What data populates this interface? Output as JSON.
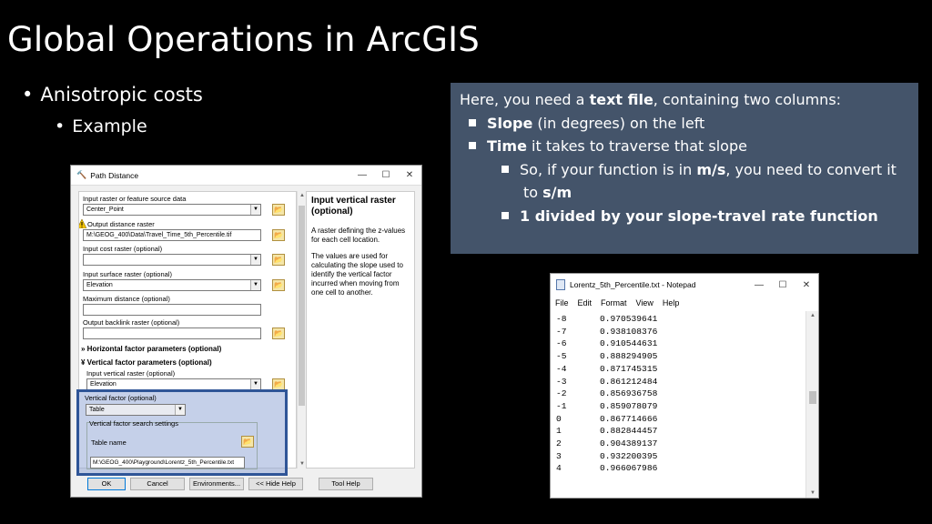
{
  "slide": {
    "title": "Global Operations in ArcGIS",
    "bullet1": "Anisotropic costs",
    "bullet2": "Example"
  },
  "info": {
    "line1_pre": "Here, you need a ",
    "line1_bold": "text file",
    "line1_post": ", containing two columns:",
    "item1_bold": "Slope",
    "item1_rest": " (in degrees) on the left",
    "item2_bold": "Time",
    "item2_rest": " it takes to traverse that slope",
    "sub1_pre": "So, if your function is in ",
    "sub1_bold": "m/s",
    "sub1_post": ", you need to convert it",
    "sub1_cont": "to ",
    "sub1_cont_bold": "s/m",
    "sub2_bold": "1 divided by your slope-travel rate function",
    "bg_color": "#44546a"
  },
  "dialog": {
    "title": "Path Distance",
    "fields": [
      {
        "label": "Input raster or feature source data",
        "value": "Center_Point"
      },
      {
        "label": "Output distance raster",
        "value": "M:\\GEOG_400\\Data\\Travel_Time_5th_Percentile.tif"
      },
      {
        "label": "Input cost raster (optional)",
        "value": ""
      },
      {
        "label": "Input surface raster (optional)",
        "value": "Elevation"
      },
      {
        "label": "Maximum distance (optional)",
        "value": ""
      },
      {
        "label": "Output backlink raster (optional)",
        "value": ""
      }
    ],
    "section_horizontal": "Horizontal factor parameters (optional)",
    "section_vertical": "Vertical factor parameters (optional)",
    "vertical_raster_label": "Input vertical raster (optional)",
    "vertical_raster_value": "Elevation",
    "vertical_factor_label": "Vertical factor (optional)",
    "vertical_factor_value": "Table",
    "search_settings_label": "Vertical factor search settings",
    "table_name_label": "Table name",
    "table_name_value": "M:\\GEOG_400\\Playground\\Lorentz_5th_Percentile.txt",
    "help_title": "Input vertical raster (optional)",
    "help_p1": "A raster defining the z-values for each cell location.",
    "help_p2": "The values are used for calculating the slope used to identify the vertical factor incurred when moving from one cell to another.",
    "buttons": [
      "OK",
      "Cancel",
      "Environments...",
      "<< Hide Help",
      "Tool Help"
    ],
    "highlight_color": "#2f5597"
  },
  "notepad": {
    "title": "Lorentz_5th_Percentile.txt - Notepad",
    "menu": [
      "File",
      "Edit",
      "Format",
      "View",
      "Help"
    ],
    "rows": [
      [
        "-8",
        "0.970539641"
      ],
      [
        "-7",
        "0.938108376"
      ],
      [
        "-6",
        "0.910544631"
      ],
      [
        "-5",
        "0.888294905"
      ],
      [
        "-4",
        "0.871745315"
      ],
      [
        "-3",
        "0.861212484"
      ],
      [
        "-2",
        "0.856936758"
      ],
      [
        "-1",
        "0.859078079"
      ],
      [
        "0",
        "0.867714666"
      ],
      [
        "1",
        "0.882844457"
      ],
      [
        "2",
        "0.904389137"
      ],
      [
        "3",
        "0.932200395"
      ],
      [
        "4",
        "0.966067986"
      ]
    ]
  }
}
